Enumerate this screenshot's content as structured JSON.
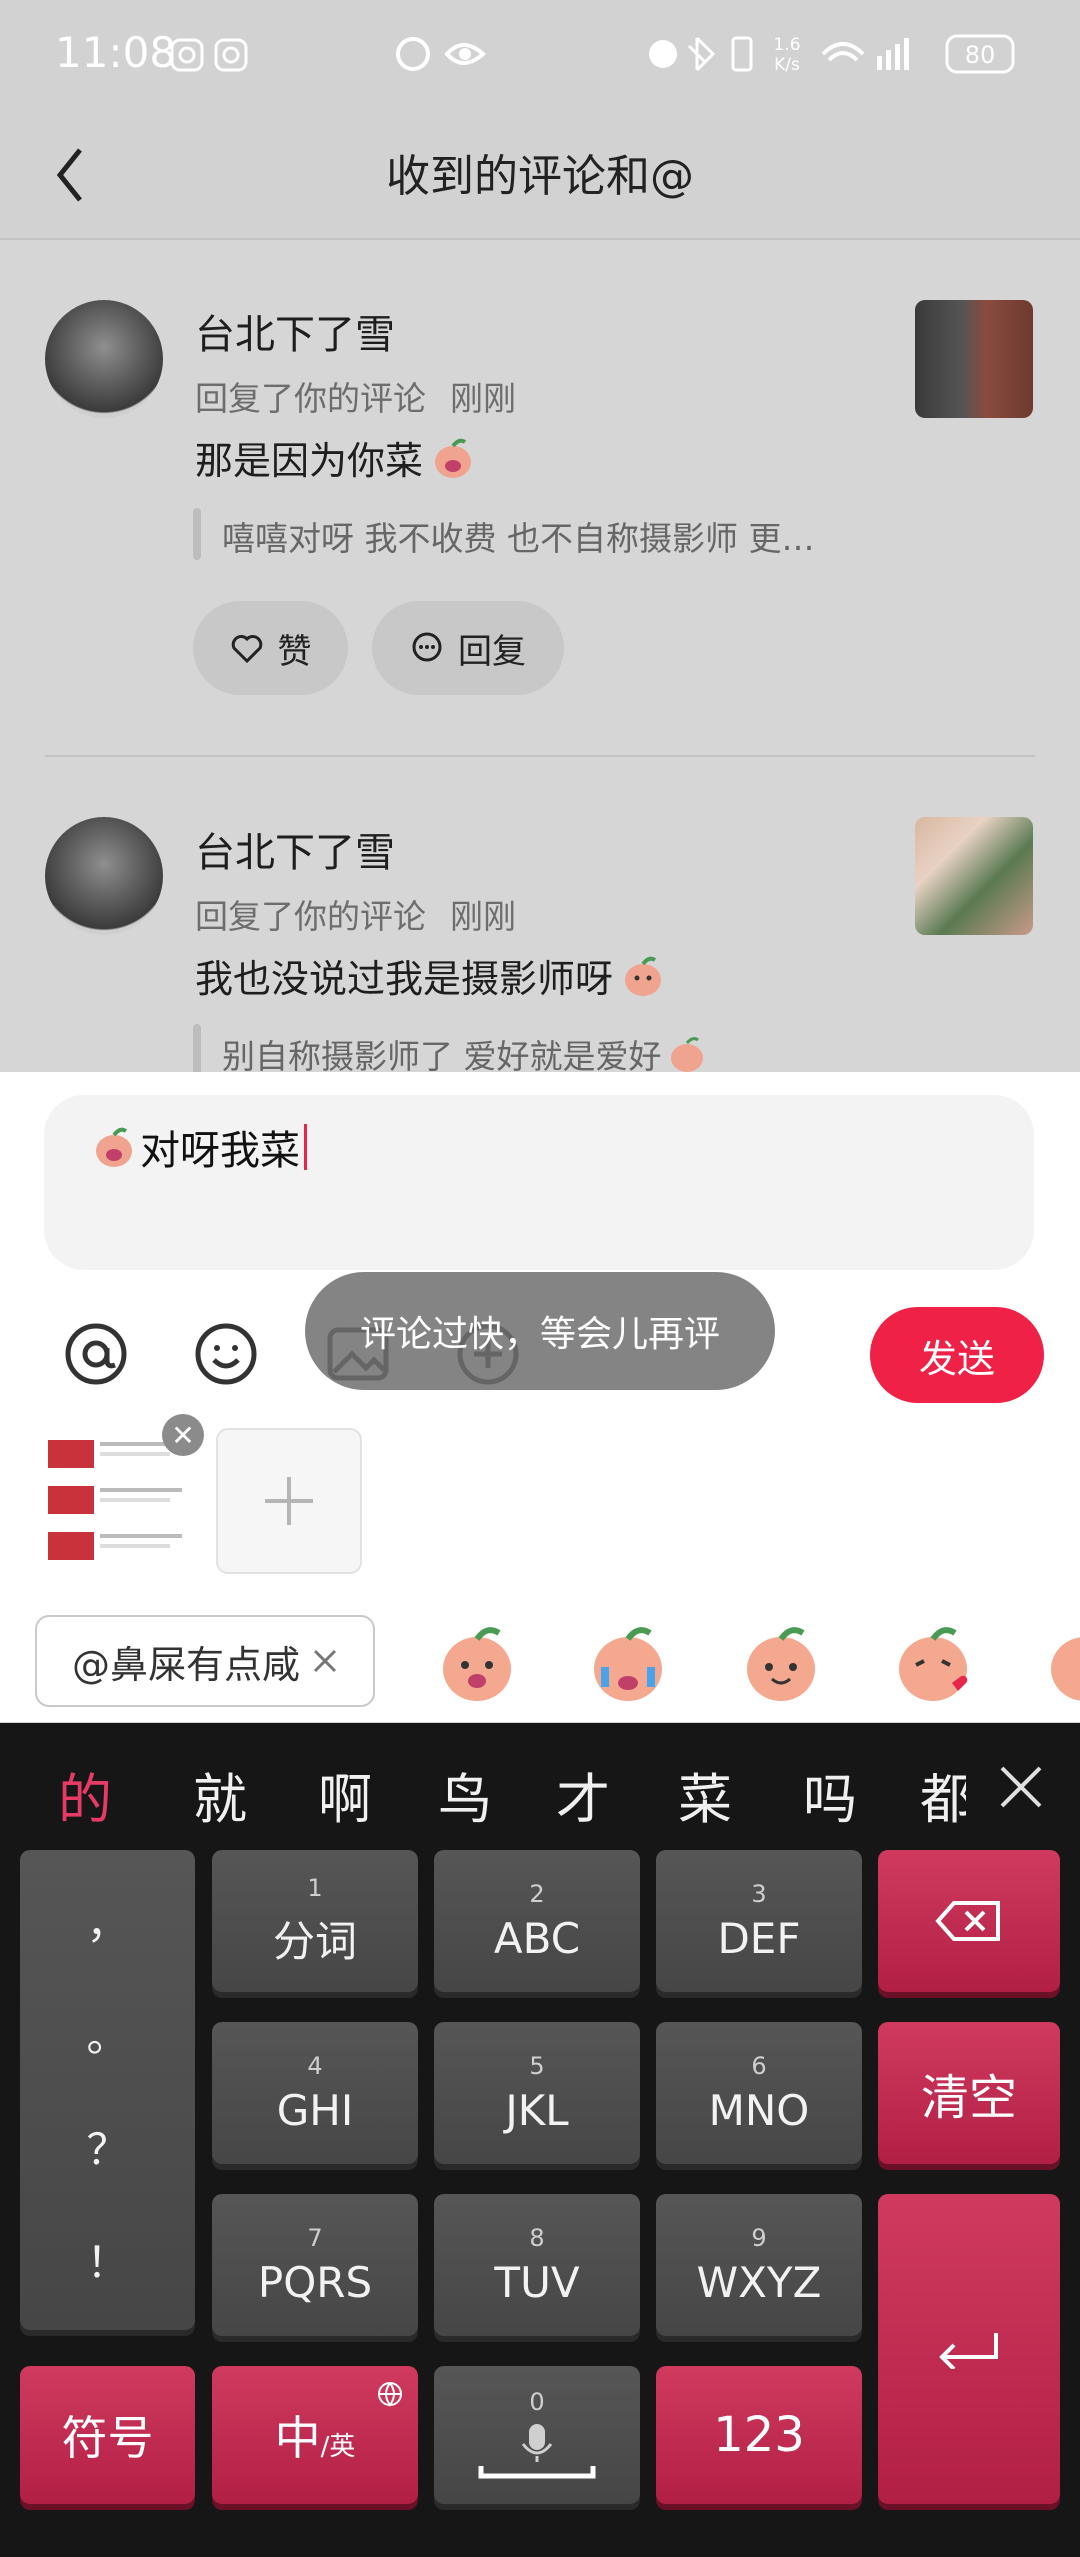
{
  "status_bar": {
    "time": "11:08",
    "net_speed": "1.6\nK/s",
    "battery": "80"
  },
  "header": {
    "title": "收到的评论和@"
  },
  "comments": [
    {
      "user": "台北下了雪",
      "action": "回复了你的评论",
      "time": "刚刚",
      "text": "那是因为你菜",
      "quote": "嘻嘻对呀 我不收费 也不自称摄影师 更…",
      "like_label": "赞",
      "reply_label": "回复"
    },
    {
      "user": "台北下了雪",
      "action": "回复了你的评论",
      "time": "刚刚",
      "text": "我也没说过我是摄影师呀",
      "quote": "别自称摄影师了 爱好就是爱好"
    }
  ],
  "composer": {
    "text": "对呀我菜",
    "send_label": "发送",
    "toast": "评论过快，等会儿再评",
    "mention_chip": "@鼻屎有点咸"
  },
  "keyboard": {
    "candidates": [
      "的",
      "就",
      "啊",
      "鸟",
      "才",
      "菜",
      "吗",
      "都"
    ],
    "punct": [
      "，",
      "。",
      "？",
      "！"
    ],
    "keys": [
      {
        "num": "1",
        "label": "分词"
      },
      {
        "num": "2",
        "label": "ABC"
      },
      {
        "num": "3",
        "label": "DEF"
      },
      {
        "num": "4",
        "label": "GHI"
      },
      {
        "num": "5",
        "label": "JKL"
      },
      {
        "num": "6",
        "label": "MNO"
      },
      {
        "num": "7",
        "label": "PQRS"
      },
      {
        "num": "8",
        "label": "TUV"
      },
      {
        "num": "9",
        "label": "WXYZ"
      }
    ],
    "clear": "清空",
    "symbols": "符号",
    "lang_main": "中",
    "lang_sub": "/英",
    "space_num": "0",
    "numbers": "123"
  },
  "colors": {
    "accent": "#ef2146",
    "candidate_active": "#e83a66",
    "keyboard_red": "#c02a50"
  }
}
